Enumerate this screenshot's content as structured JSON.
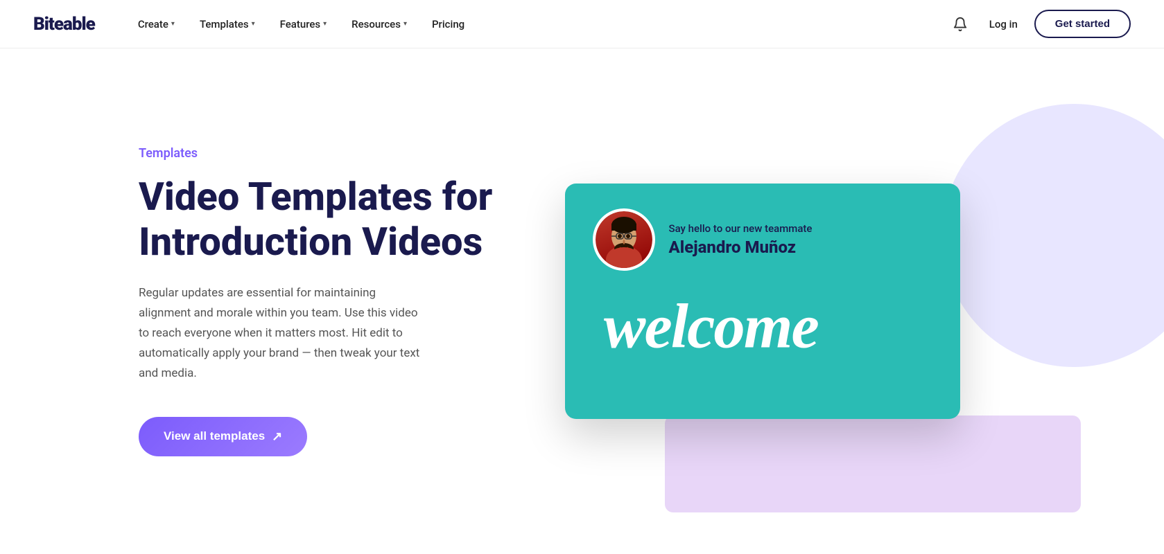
{
  "brand": {
    "logo": "Biteable"
  },
  "navbar": {
    "links": [
      {
        "label": "Create",
        "has_dropdown": true
      },
      {
        "label": "Templates",
        "has_dropdown": true
      },
      {
        "label": "Features",
        "has_dropdown": true
      },
      {
        "label": "Resources",
        "has_dropdown": true
      },
      {
        "label": "Pricing",
        "has_dropdown": false
      }
    ],
    "login_label": "Log in",
    "get_started_label": "Get started"
  },
  "hero": {
    "label": "Templates",
    "title": "Video Templates for Introduction Videos",
    "description": "Regular updates are essential for maintaining alignment and morale within you team. Use this video to reach everyone when it matters most. Hit edit to automatically apply your brand — then tweak your text and media.",
    "cta_label": "View all templates",
    "cta_arrow": "↗"
  },
  "video_card": {
    "subtitle": "Say hello to our new teammate",
    "name": "Alejandro Muñoz",
    "welcome_text": "welcome",
    "bg_color": "#2abcb4"
  },
  "colors": {
    "brand_purple": "#7c5cfc",
    "brand_dark": "#1a1a4e",
    "teal": "#2abcb4",
    "bg_light_purple": "#e8e6ff",
    "bg_light_pink": "#e8d6f8"
  }
}
